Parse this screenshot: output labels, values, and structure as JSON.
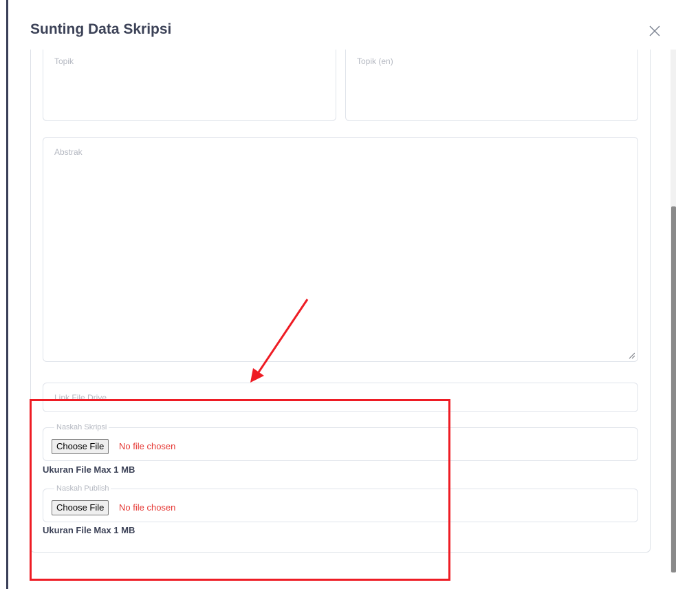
{
  "modal": {
    "title": "Sunting Data Skripsi",
    "close_icon": "close-icon"
  },
  "form": {
    "topik_placeholder": "Topik",
    "topik_en_placeholder": "Topik (en)",
    "abstrak_placeholder": "Abstrak",
    "link_placeholder": "Link File Drive",
    "naskah_skripsi": {
      "legend": "Naskah Skripsi",
      "button_label": "Choose File",
      "status": "No file chosen",
      "note": "Ukuran File Max 1 MB"
    },
    "naskah_publish": {
      "legend": "Naskah Publish",
      "button_label": "Choose File",
      "status": "No file chosen",
      "note": "Ukuran File Max 1 MB"
    }
  },
  "annotation": {
    "color": "#ee1c24"
  }
}
